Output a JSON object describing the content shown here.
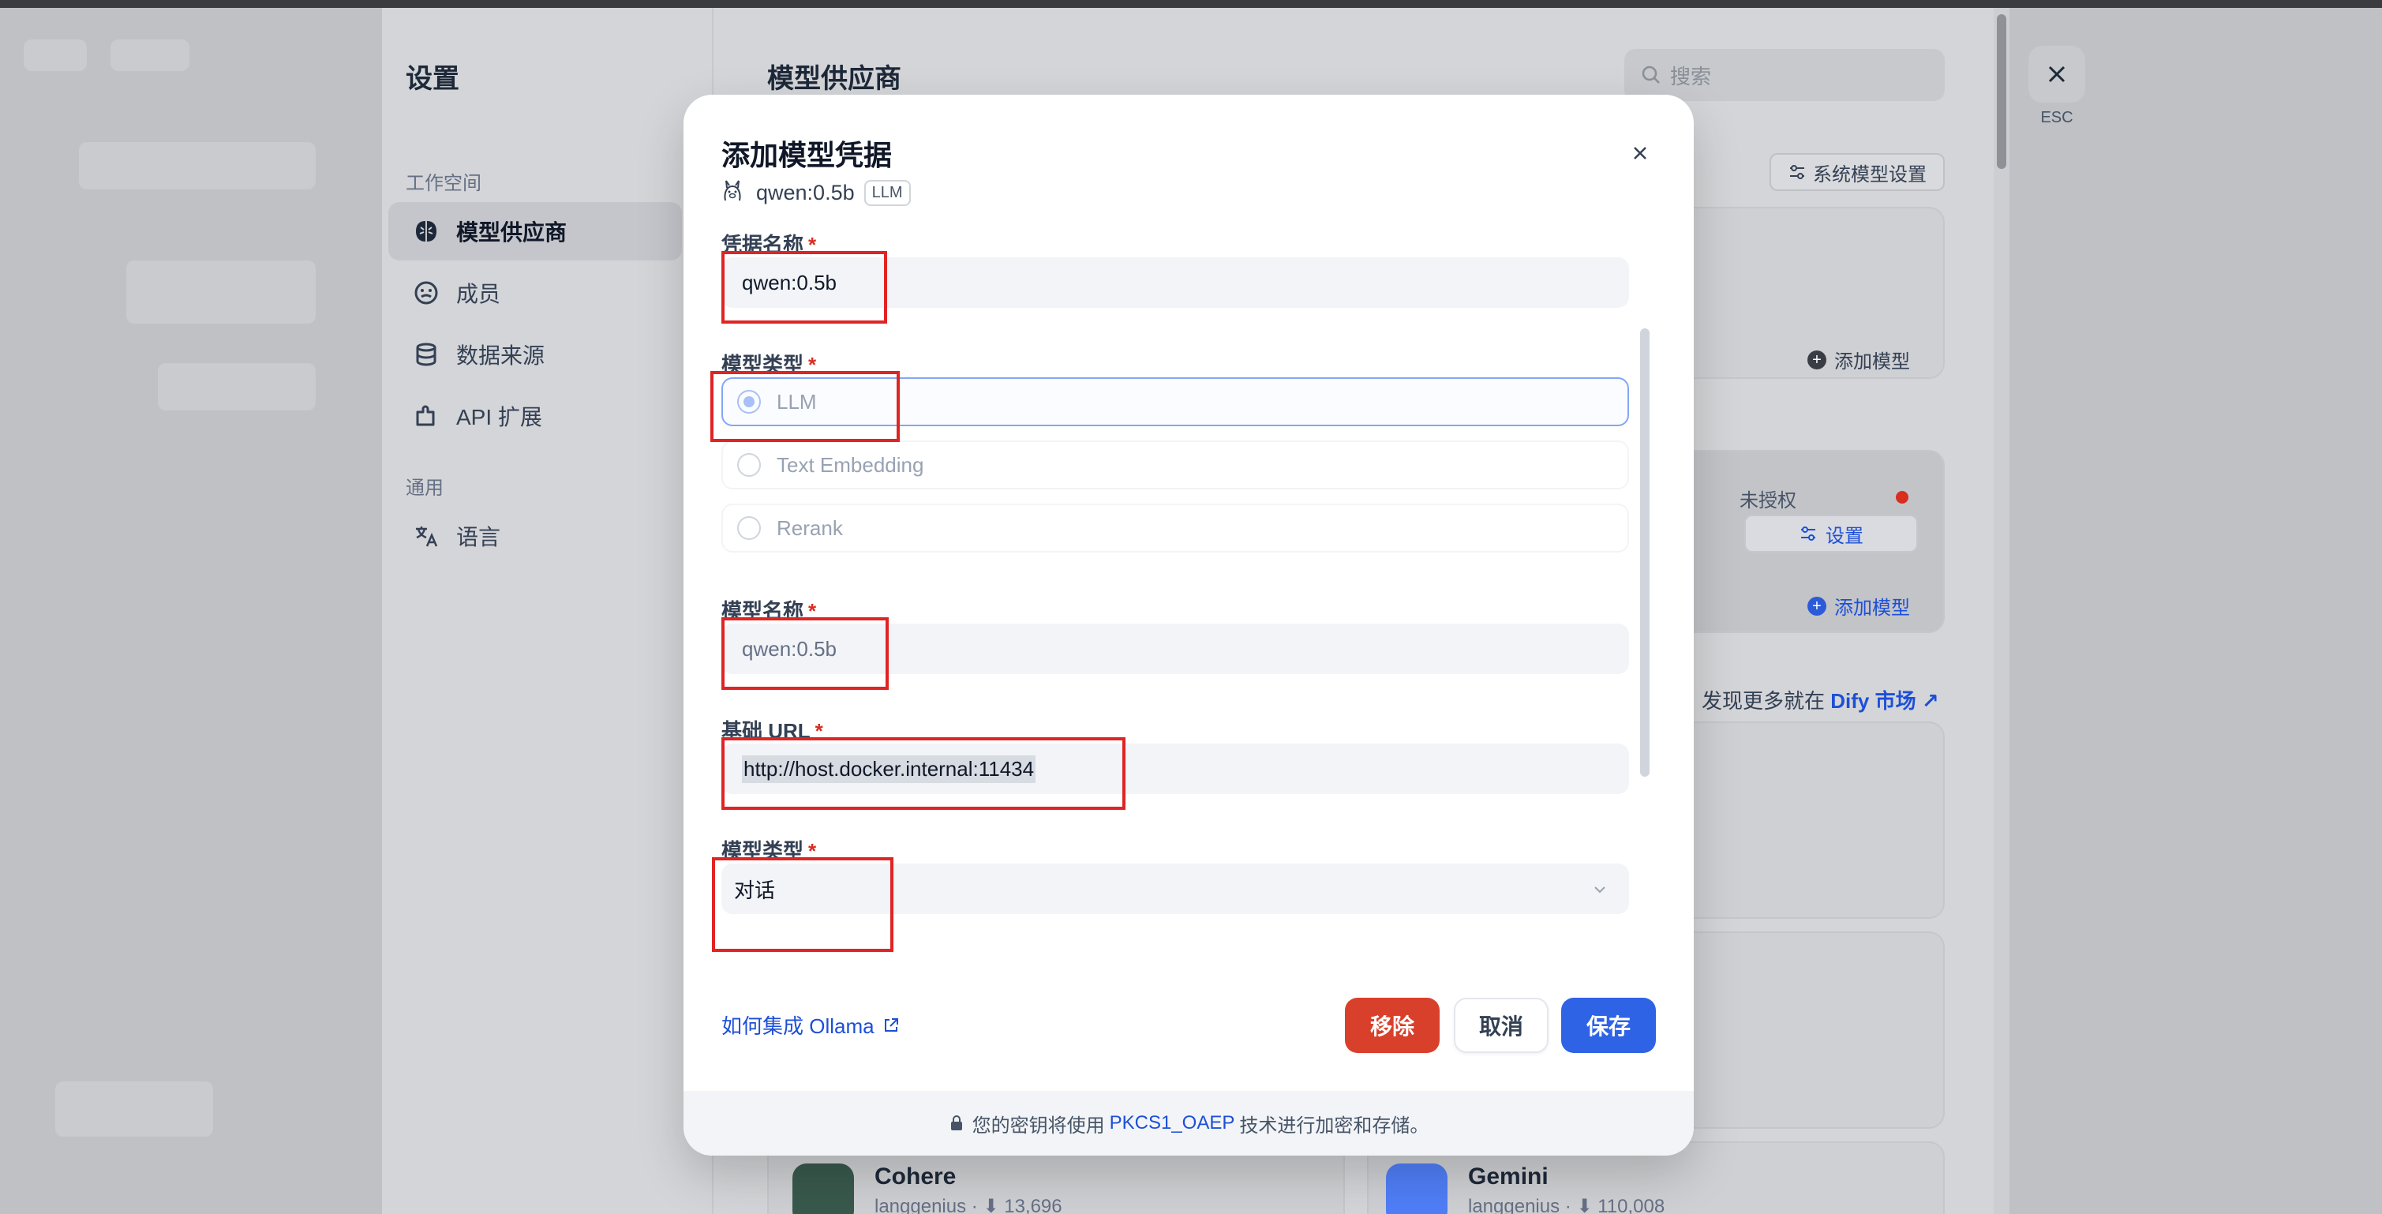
{
  "settings": {
    "title": "设置",
    "groups": [
      {
        "label": "工作空间",
        "items": [
          {
            "label": "模型供应商",
            "icon": "brain-icon"
          },
          {
            "label": "成员",
            "icon": "members-icon"
          },
          {
            "label": "数据来源",
            "icon": "database-icon"
          },
          {
            "label": "API 扩展",
            "icon": "puzzle-icon"
          }
        ]
      },
      {
        "label": "通用",
        "items": [
          {
            "label": "语言",
            "icon": "translate-icon"
          }
        ]
      }
    ]
  },
  "main": {
    "title": "模型供应商",
    "search_placeholder": "搜索",
    "system_settings_label": "系统模型设置",
    "add_model_label": "添加模型",
    "unauthorized_label": "未授权",
    "setup_label": "设置",
    "discover_prefix": "发现更多就在",
    "discover_link": "Dify 市场 ↗",
    "providers": [
      {
        "name": "Cohere",
        "author": "langgenius",
        "downloads": "13,696",
        "color": "#39594d"
      },
      {
        "name": "Gemini",
        "author": "langgenius",
        "downloads": "110,008",
        "color": "#4f7ef7"
      }
    ]
  },
  "esc_label": "ESC",
  "modal": {
    "title": "添加模型凭据",
    "model_id": "qwen:0.5b",
    "model_badge": "LLM",
    "fields": {
      "credential_name": {
        "label": "凭据名称",
        "value": "qwen:0.5b"
      },
      "model_type": {
        "label": "模型类型",
        "options": [
          "LLM",
          "Text Embedding",
          "Rerank"
        ],
        "selected": "LLM"
      },
      "model_name": {
        "label": "模型名称",
        "placeholder": "qwen:0.5b"
      },
      "base_url": {
        "label": "基础 URL",
        "value": "http://host.docker.internal:11434"
      },
      "completion_mode": {
        "label": "模型类型",
        "value": "对话"
      }
    },
    "help_link": "如何集成 Ollama",
    "buttons": {
      "remove": "移除",
      "cancel": "取消",
      "save": "保存"
    },
    "footer": {
      "prefix": "您的密钥将使用",
      "highlight": "PKCS1_OAEP",
      "suffix": "技术进行加密和存储。"
    }
  }
}
